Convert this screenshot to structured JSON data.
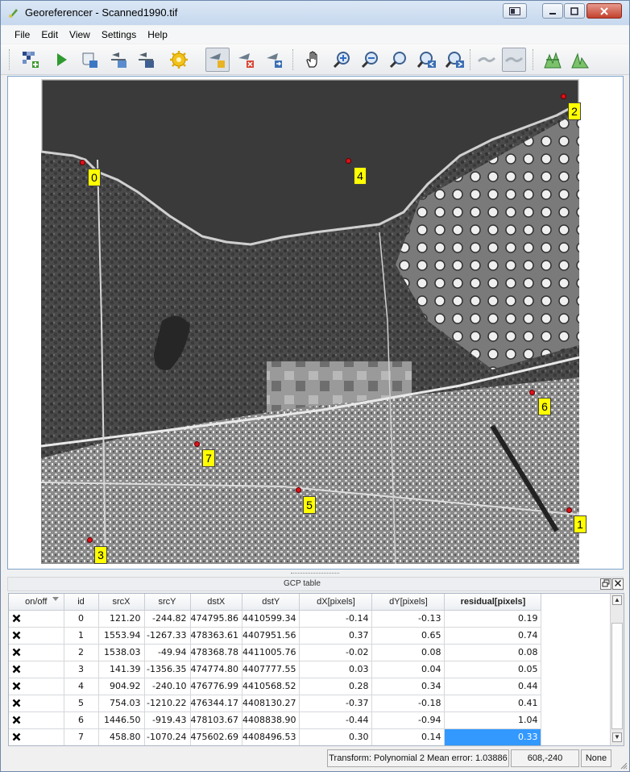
{
  "window": {
    "title": "Georeferencer - Scanned1990.tif"
  },
  "menubar": [
    "File",
    "Edit",
    "View",
    "Settings",
    "Help"
  ],
  "toolbar": {
    "tools": [
      "open-raster-icon",
      "start-georeferencing-icon",
      "generate-gdal-script-icon",
      "load-gcp-points-icon",
      "save-gcp-points-icon",
      "transformation-settings-icon",
      "add-point-icon",
      "delete-point-icon",
      "move-gcp-point-icon",
      "pan-icon",
      "zoom-in-icon",
      "zoom-out-icon",
      "zoom-to-layer-icon",
      "zoom-last-icon",
      "zoom-next-icon",
      "link-georeferencer-to-qgis-icon",
      "link-qgis-to-georeferencer-icon",
      "full-histogram-stretch-icon",
      "local-histogram-stretch-icon"
    ]
  },
  "map": {
    "gcps": [
      {
        "label": "0"
      },
      {
        "label": "1"
      },
      {
        "label": "2"
      },
      {
        "label": "3"
      },
      {
        "label": "4"
      },
      {
        "label": "5"
      },
      {
        "label": "6"
      },
      {
        "label": "7"
      }
    ]
  },
  "gcp_panel": {
    "title": "GCP table",
    "columns": [
      "on/off",
      "id",
      "srcX",
      "srcY",
      "dstX",
      "dstY",
      "dX[pixels]",
      "dY[pixels]",
      "residual[pixels]"
    ],
    "rows": [
      {
        "id": "0",
        "srcX": "121.20",
        "srcY": "-244.82",
        "dstX": "474795.86",
        "dstY": "4410599.34",
        "dX": "-0.14",
        "dY": "-0.13",
        "residual": "0.19"
      },
      {
        "id": "1",
        "srcX": "1553.94",
        "srcY": "-1267.33",
        "dstX": "478363.61",
        "dstY": "4407951.56",
        "dX": "0.37",
        "dY": "0.65",
        "residual": "0.74"
      },
      {
        "id": "2",
        "srcX": "1538.03",
        "srcY": "-49.94",
        "dstX": "478368.78",
        "dstY": "4411005.76",
        "dX": "-0.02",
        "dY": "0.08",
        "residual": "0.08"
      },
      {
        "id": "3",
        "srcX": "141.39",
        "srcY": "-1356.35",
        "dstX": "474774.80",
        "dstY": "4407777.55",
        "dX": "0.03",
        "dY": "0.04",
        "residual": "0.05"
      },
      {
        "id": "4",
        "srcX": "904.92",
        "srcY": "-240.10",
        "dstX": "476776.99",
        "dstY": "4410568.52",
        "dX": "0.28",
        "dY": "0.34",
        "residual": "0.44"
      },
      {
        "id": "5",
        "srcX": "754.03",
        "srcY": "-1210.22",
        "dstX": "476344.17",
        "dstY": "4408130.27",
        "dX": "-0.37",
        "dY": "-0.18",
        "residual": "0.41"
      },
      {
        "id": "6",
        "srcX": "1446.50",
        "srcY": "-919.43",
        "dstX": "478103.67",
        "dstY": "4408838.90",
        "dX": "-0.44",
        "dY": "-0.94",
        "residual": "1.04"
      },
      {
        "id": "7",
        "srcX": "458.80",
        "srcY": "-1070.24",
        "dstX": "475602.69",
        "dstY": "4408496.53",
        "dX": "0.30",
        "dY": "0.14",
        "residual": "0.33"
      }
    ],
    "selected_row": 7
  },
  "statusbar": {
    "transform": "Transform: Polynomial 2 Mean error: 1.03886",
    "coords": "608,-240",
    "crs": "None"
  },
  "colors": {
    "gcp_label": "#ffff00",
    "gcp_marker": "#e0101a",
    "selection": "#3399ff"
  }
}
